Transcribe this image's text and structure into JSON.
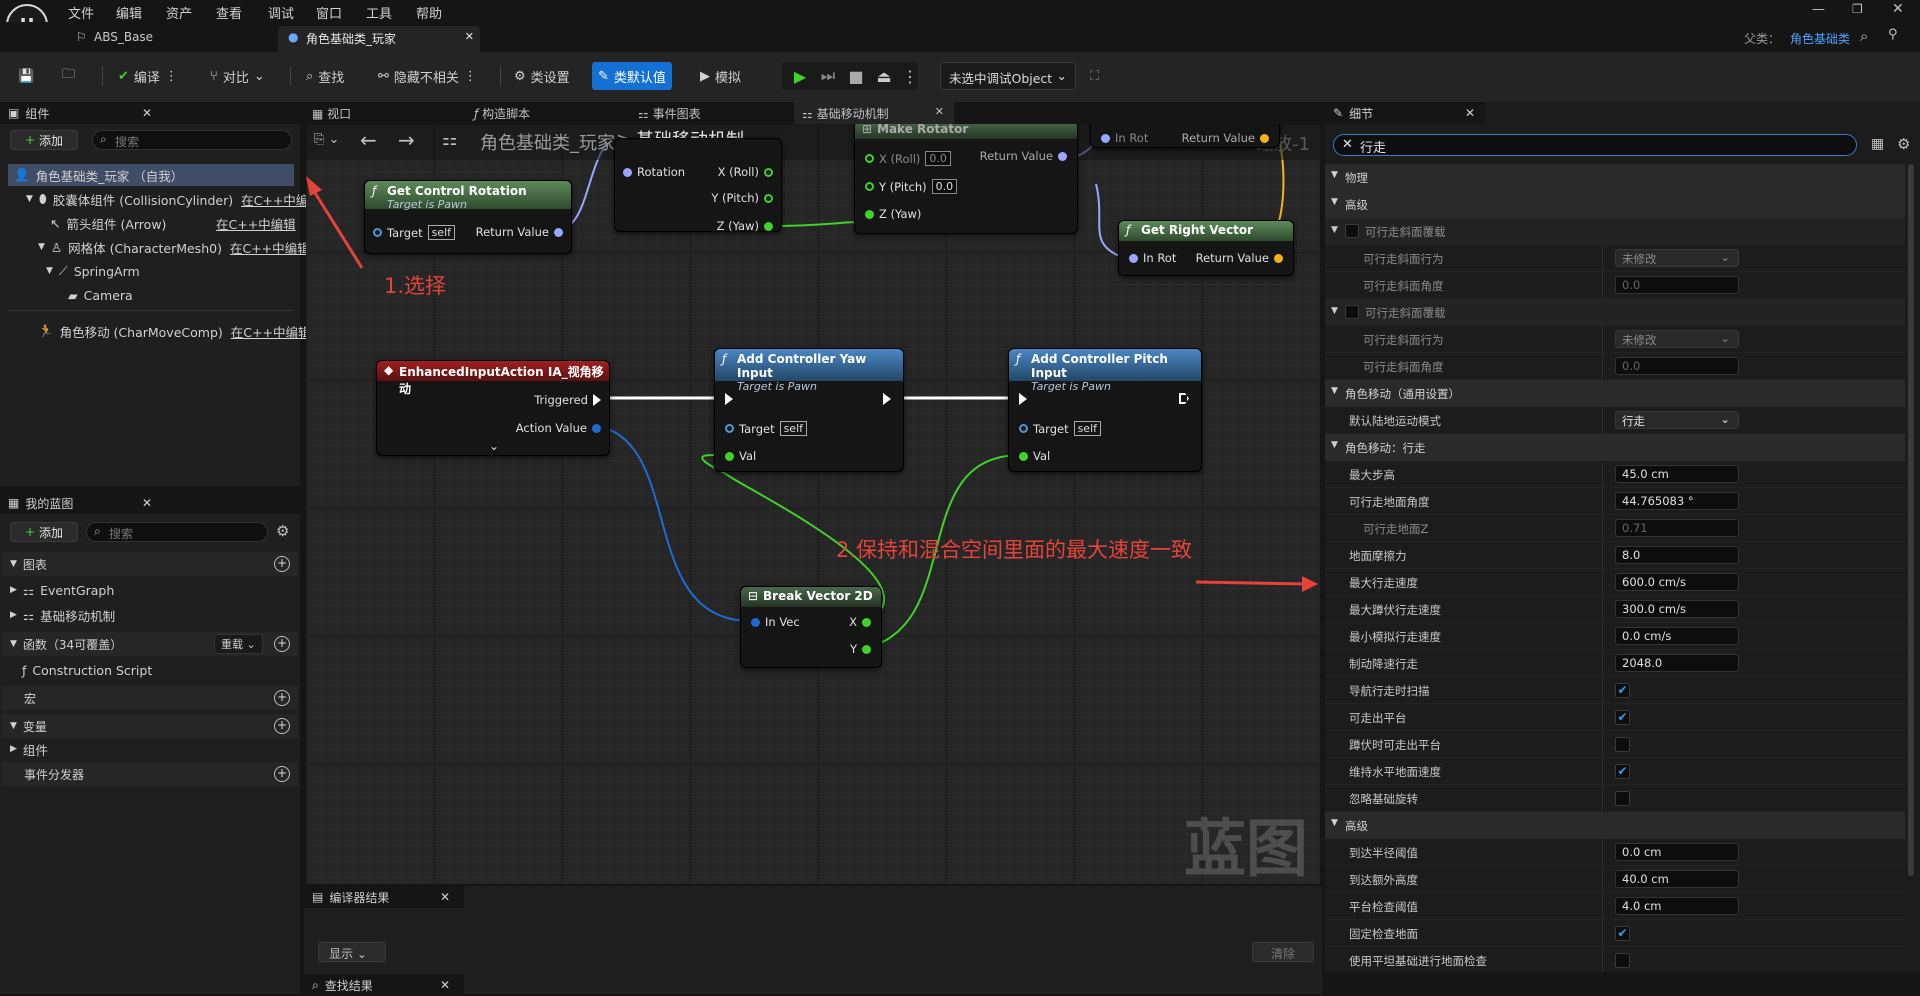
{
  "menu": [
    "文件",
    "编辑",
    "资产",
    "查看",
    "调试",
    "窗口",
    "工具",
    "帮助"
  ],
  "doc_tabs": [
    {
      "label": "ABS_Base",
      "active": false
    },
    {
      "label": "角色基础类_玩家",
      "active": true
    }
  ],
  "parent": {
    "label": "父类：",
    "value": "角色基础类"
  },
  "toolbar": {
    "compile": "编译",
    "diff": "对比",
    "find": "查找",
    "hide_unrelated": "隐藏不相关",
    "class_settings": "类设置",
    "class_defaults": "类默认值",
    "simulate": "模拟",
    "debug_object": "未选中调试Object"
  },
  "components": {
    "title": "组件",
    "add": "添加",
    "search_placeholder": "搜索",
    "items": [
      {
        "label": "角色基础类_玩家 （自我）",
        "editable": ""
      },
      {
        "label": "胶囊体组件 (CollisionCylinder)",
        "editable": "在C++中编"
      },
      {
        "label": "箭头组件 (Arrow)",
        "editable": "在C++中编辑"
      },
      {
        "label": "网格体 (CharacterMesh0)",
        "editable": "在C++中编辑"
      },
      {
        "label": "SpringArm",
        "editable": ""
      },
      {
        "label": "Camera",
        "editable": ""
      },
      {
        "label": "角色移动 (CharMoveComp)",
        "editable": "在C++中编辑"
      }
    ]
  },
  "my_blueprint": {
    "title": "我的蓝图",
    "add": "添加",
    "search_placeholder": "搜索",
    "graphs_label": "图表",
    "graphs": [
      "EventGraph",
      "基础移动机制"
    ],
    "functions_label": "函数（34可覆盖）",
    "override": "重载",
    "construction": "Construction Script",
    "macros": "宏",
    "variables": "变量",
    "components_cat": "组件",
    "dispatchers": "事件分发器"
  },
  "graph_tabs": [
    "视口",
    "构造脚本",
    "事件图表",
    "基础移动机制"
  ],
  "graph": {
    "breadcrumb_root": "角色基础类_玩家",
    "breadcrumb_current": "基础移动机制",
    "zoom": "缩放-1",
    "watermark": "蓝图",
    "nodes": {
      "get_control_rotation": {
        "title": "Get Control Rotation",
        "sub": "Target is Pawn",
        "target": "Target",
        "self": "self",
        "ret": "Return Value"
      },
      "break_rotator": {
        "rotation": "Rotation",
        "x": "X (Roll)",
        "y": "Y (Pitch)",
        "z": "Z (Yaw)"
      },
      "make_rotator": {
        "title": "Make Rotator",
        "x": "X (Roll)",
        "y": "Y (Pitch)",
        "z": "Z (Yaw)",
        "zero": "0.0",
        "ret": "Return Value"
      },
      "top_right": {
        "in": "In Rot",
        "ret": "Return Value"
      },
      "get_right_vector": {
        "title": "Get Right Vector",
        "in": "In Rot",
        "ret": "Return Value"
      },
      "enhanced_input": {
        "title": "EnhancedInputAction IA_视角移动",
        "triggered": "Triggered",
        "action_value": "Action Value"
      },
      "yaw_input": {
        "title": "Add Controller Yaw Input",
        "sub": "Target is Pawn",
        "target": "Target",
        "self": "self",
        "val": "Val"
      },
      "pitch_input": {
        "title": "Add Controller Pitch Input",
        "sub": "Target is Pawn",
        "target": "Target",
        "self": "self",
        "val": "Val"
      },
      "break_vector": {
        "title": "Break Vector 2D",
        "in": "In Vec",
        "x": "X",
        "y": "Y"
      }
    }
  },
  "annotations": {
    "step1": "1.选择",
    "step2": "2.保持和混合空间里面的最大速度一致"
  },
  "bottom": {
    "compiler_results": "编译器结果",
    "show": "显示",
    "clear": "清除",
    "find_results": "查找结果"
  },
  "details": {
    "title": "细节",
    "search_value": "行走",
    "rows": [
      {
        "kind": "cat",
        "label": "物理",
        "indent": 0
      },
      {
        "kind": "cat",
        "label": "高级",
        "indent": 0
      },
      {
        "kind": "group",
        "label": "可行走斜面覆载"
      },
      {
        "kind": "dd",
        "label": "可行走斜面行为",
        "value": "未修改",
        "dim": true
      },
      {
        "kind": "val",
        "label": "可行走斜面角度",
        "value": "0.0",
        "dim": true
      },
      {
        "kind": "group",
        "label": "可行走斜面覆载"
      },
      {
        "kind": "dd",
        "label": "可行走斜面行为",
        "value": "未修改",
        "dim": true
      },
      {
        "kind": "val",
        "label": "可行走斜面角度",
        "value": "0.0",
        "dim": true
      },
      {
        "kind": "cat",
        "label": "角色移动（通用设置）"
      },
      {
        "kind": "dd",
        "label": "默认陆地运动模式",
        "value": "行走"
      },
      {
        "kind": "cat",
        "label": "角色移动：行走"
      },
      {
        "kind": "val",
        "label": "最大步高",
        "value": "45.0 cm"
      },
      {
        "kind": "val",
        "label": "可行走地面角度",
        "value": "44.765083 °"
      },
      {
        "kind": "val",
        "label": "可行走地面Z",
        "value": "0.71",
        "dim": true
      },
      {
        "kind": "val",
        "label": "地面摩擦力",
        "value": "8.0"
      },
      {
        "kind": "val",
        "label": "最大行走速度",
        "value": "600.0 cm/s"
      },
      {
        "kind": "val",
        "label": "最大蹲伏行走速度",
        "value": "300.0 cm/s"
      },
      {
        "kind": "val",
        "label": "最小模拟行走速度",
        "value": "0.0 cm/s"
      },
      {
        "kind": "val",
        "label": "制动降速行走",
        "value": "2048.0"
      },
      {
        "kind": "cb",
        "label": "导航行走时扫描",
        "checked": true
      },
      {
        "kind": "cb",
        "label": "可走出平台",
        "checked": true
      },
      {
        "kind": "cb",
        "label": "蹲伏时可走出平台",
        "checked": false
      },
      {
        "kind": "cb",
        "label": "维持水平地面速度",
        "checked": true
      },
      {
        "kind": "cb",
        "label": "忽略基础旋转",
        "checked": false
      },
      {
        "kind": "cat",
        "label": "高级"
      },
      {
        "kind": "val",
        "label": "到达半径阈值",
        "value": "0.0 cm"
      },
      {
        "kind": "val",
        "label": "到达额外高度",
        "value": "40.0 cm"
      },
      {
        "kind": "val",
        "label": "平台检查阈值",
        "value": "4.0 cm"
      },
      {
        "kind": "cb",
        "label": "固定检查地面",
        "checked": true
      },
      {
        "kind": "cb",
        "label": "使用平坦基础进行地面检查",
        "checked": false
      }
    ]
  },
  "colors": {
    "accent": "#1570d4",
    "exec": "#ffffff",
    "float": "#3fd22a",
    "rotator": "#9aa6ff",
    "vector": "#f5b21a",
    "vec2d": "#1f6bd1",
    "pawn": "#4a87c4",
    "event": "#8a1a1a",
    "pure": "#5e8a5a",
    "annotation": "#e5423a"
  }
}
